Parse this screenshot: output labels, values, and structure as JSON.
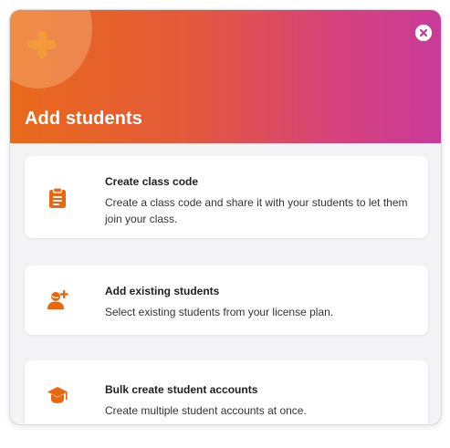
{
  "dialog": {
    "title": "Add students",
    "close_icon": "close-circle-icon",
    "header_icon": "plus-icon",
    "colors": {
      "accent": "#e96a1b",
      "gradient_start": "#e96a1b",
      "gradient_end": "#c93b9a"
    }
  },
  "options": [
    {
      "icon": "clipboard-icon",
      "title": "Create class code",
      "description": "Create a class code and share it with your students to let them join your class."
    },
    {
      "icon": "add-user-icon",
      "title": "Add existing students",
      "description": "Select existing students from your license plan."
    },
    {
      "icon": "graduation-cap-icon",
      "title": "Bulk create student accounts",
      "description": "Create multiple student accounts at once."
    }
  ]
}
